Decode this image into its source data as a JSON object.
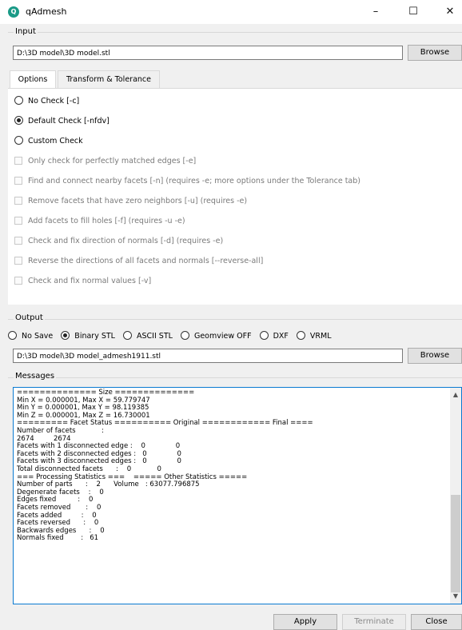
{
  "window": {
    "title": "qAdmesh",
    "icon": "qadmesh-app-icon",
    "minimize": "–",
    "maximize": "☐",
    "close": "✕"
  },
  "input": {
    "group_label": "Input",
    "path": "D:\\3D model\\3D model.stl",
    "browse_label": "Browse"
  },
  "tabs": [
    {
      "label": "Options",
      "active": true
    },
    {
      "label": "Transform & Tolerance",
      "active": false
    }
  ],
  "options": {
    "radios": [
      {
        "label": "No Check [-c]",
        "checked": false
      },
      {
        "label": "Default Check [-nfdv]",
        "checked": true
      },
      {
        "label": "Custom Check",
        "checked": false
      }
    ],
    "checks": [
      {
        "label": "Only check for perfectly matched edges [-e]",
        "checked": false,
        "enabled": false
      },
      {
        "label": "Find and connect nearby facets [-n] (requires -e; more options under the Tolerance tab)",
        "checked": false,
        "enabled": false
      },
      {
        "label": "Remove facets that have zero neighbors [-u] (requires -e)",
        "checked": false,
        "enabled": false
      },
      {
        "label": "Add facets to fill holes [-f] (requires -u -e)",
        "checked": false,
        "enabled": false
      },
      {
        "label": "Check and fix direction of normals [-d] (requires -e)",
        "checked": false,
        "enabled": false
      },
      {
        "label": "Reverse the directions of all facets and normals [--reverse-all]",
        "checked": false,
        "enabled": false
      },
      {
        "label": "Check and fix normal values [-v]",
        "checked": false,
        "enabled": false
      }
    ]
  },
  "output": {
    "group_label": "Output",
    "formats": [
      {
        "label": "No Save",
        "checked": false
      },
      {
        "label": "Binary STL",
        "checked": true
      },
      {
        "label": "ASCII STL",
        "checked": false
      },
      {
        "label": "Geomview OFF",
        "checked": false
      },
      {
        "label": "DXF",
        "checked": false
      },
      {
        "label": "VRML",
        "checked": false
      }
    ],
    "path": "D:\\3D model\\3D model_admesh1911.stl",
    "browse_label": "Browse"
  },
  "messages": {
    "group_label": "Messages",
    "lines": [
      "============== Size ==============",
      "Min X = 0.000001, Max X = 59.779747",
      "Min Y = 0.000001, Max Y = 98.119385",
      "Min Z = 0.000001, Max Z = 16.730001",
      "========= Facet Status ========== Original ============ Final ====",
      "Number of facets            :",
      "2674         2674",
      "Facets with 1 disconnected edge :    0              0",
      "Facets with 2 disconnected edges :   0              0",
      "Facets with 3 disconnected edges :   0              0",
      "Total disconnected facets      :    0            0",
      "=== Processing Statistics ===    ===== Other Statistics =====",
      "Number of parts      :    2      Volume   : 63077.796875",
      "Degenerate facets    :    0",
      "Edges fixed          :    0",
      "Facets removed       :    0",
      "Facets added         :    0",
      "Facets reversed      :    0",
      "Backwards edges      :    0",
      "Normals fixed        :   61"
    ]
  },
  "footer": {
    "apply_label": "Apply",
    "terminate_label": "Terminate",
    "close_label": "Close"
  }
}
